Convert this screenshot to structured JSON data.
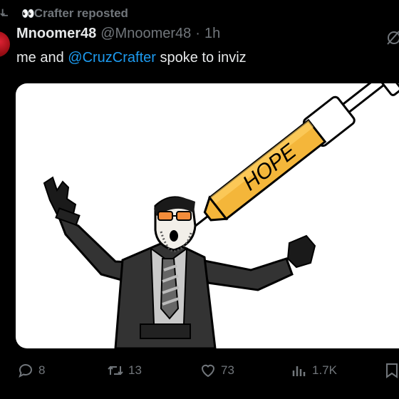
{
  "repost": {
    "icon": "repost-icon",
    "eyes": "👀",
    "label": "Crafter reposted"
  },
  "author": {
    "name": "Mnoomer48",
    "handle": "@Mnoomer48",
    "separator": "·",
    "time": "1h"
  },
  "tweet": {
    "prefix": "me and ",
    "mention": "@CruzCrafter",
    "suffix": " spoke to inviz"
  },
  "media": {
    "syringe_text": "HOPE",
    "kind": "cartoon-illustration"
  },
  "actions": {
    "replies": {
      "icon": "reply-icon",
      "count": "8"
    },
    "reposts": {
      "icon": "repost-icon",
      "count": "13"
    },
    "likes": {
      "icon": "heart-icon",
      "count": "73"
    },
    "views": {
      "icon": "views-icon",
      "count": "1.7K"
    },
    "bookmark": {
      "icon": "bookmark-icon"
    }
  },
  "colors": {
    "accent": "#1d9bf0",
    "muted": "#71767b",
    "background": "#000000",
    "avatar": "#b1121a"
  }
}
